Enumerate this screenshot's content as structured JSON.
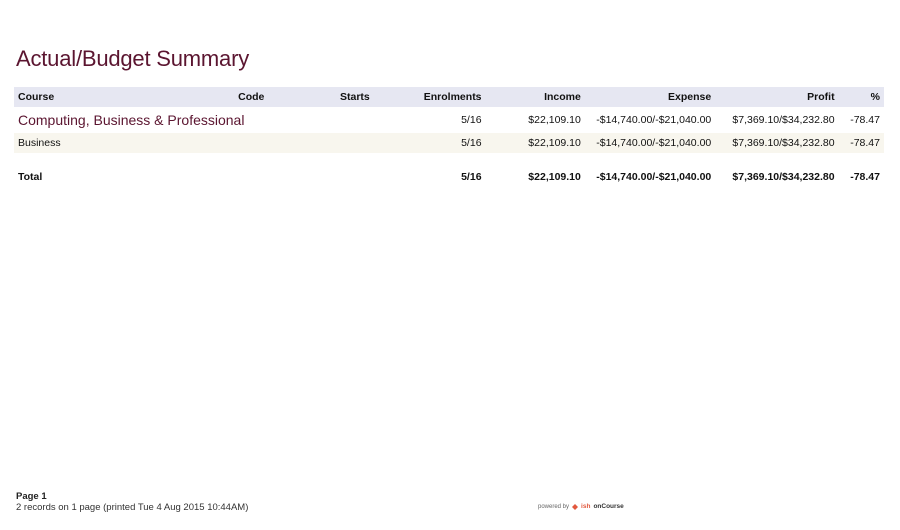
{
  "report": {
    "title": "Actual/Budget Summary"
  },
  "table": {
    "headers": {
      "course": "Course",
      "code": "Code",
      "starts": "Starts",
      "enrolments": "Enrolments",
      "income": "Income",
      "expense": "Expense",
      "profit": "Profit",
      "percent": "%"
    },
    "group": {
      "name": "Computing, Business & Professional",
      "enrolments": "5/16",
      "income": "$22,109.10",
      "expense": "-$14,740.00/-$21,040.00",
      "profit": "$7,369.10/$34,232.80",
      "percent": "-78.47"
    },
    "row": {
      "course": "Business",
      "code": "",
      "starts": "",
      "enrolments": "5/16",
      "income": "$22,109.10",
      "expense": "-$14,740.00/-$21,040.00",
      "profit": "$7,369.10/$34,232.80",
      "percent": "-78.47"
    },
    "total": {
      "label": "Total",
      "enrolments": "5/16",
      "income": "$22,109.10",
      "expense": "-$14,740.00/-$21,040.00",
      "profit": "$7,369.10/$34,232.80",
      "percent": "-78.47"
    }
  },
  "footer": {
    "page": "Page 1",
    "records": "2 records on 1 page (printed Tue 4 Aug 2015 10:44AM)",
    "powered_by": "powered by",
    "brand_ish": "ish",
    "brand_oncourse": "onCourse",
    "brand_color": "#e2583e"
  }
}
